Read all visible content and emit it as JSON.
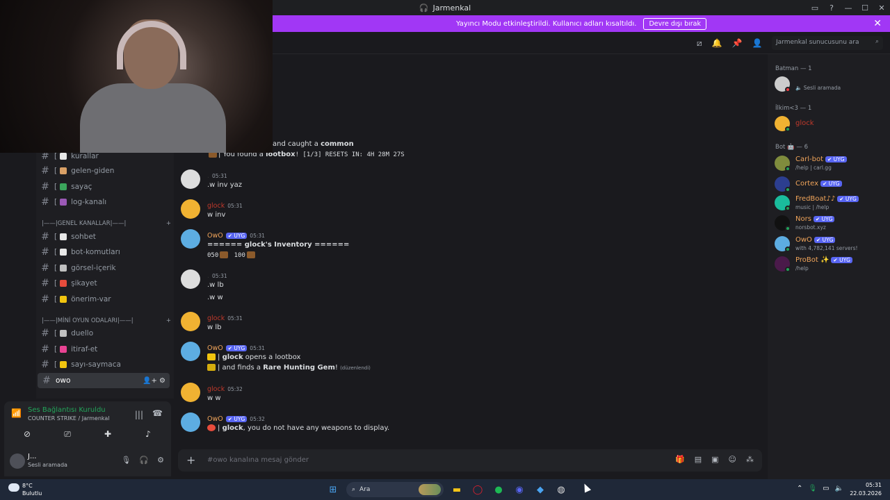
{
  "window": {
    "title": "Jarmenkal",
    "icons": [
      "inbox-icon",
      "help-icon",
      "minimize-icon",
      "maximize-icon",
      "close-icon"
    ]
  },
  "banner": {
    "text": "Yayıncı Modu etkinleştirildi. Kullanıcı adları kısaltıldı.",
    "button": "Devre dışı bırak"
  },
  "sidebar": {
    "channels": [
      {
        "name": "kurallar",
        "color": "#e8e8e8"
      },
      {
        "name": "gelen-giden",
        "color": "#d9a066"
      },
      {
        "name": "sayaç",
        "color": "#3ba55c"
      },
      {
        "name": "log-kanalı",
        "color": "#9b59b6"
      }
    ],
    "category1": "|——|GENEL KANALLAR|——|",
    "channels2": [
      {
        "name": "sohbet",
        "color": "#e8e8e8"
      },
      {
        "name": "bot-komutları",
        "color": "#e8e8e8"
      },
      {
        "name": "görsel-içerik",
        "color": "#c0c0c0"
      },
      {
        "name": "şikayet",
        "color": "#e74c3c"
      },
      {
        "name": "önerim-var",
        "color": "#f1c40f"
      }
    ],
    "category2": "|——|MİNİ OYUN ODALARI|——|",
    "channels3": [
      {
        "name": "duello",
        "color": "#c0c0c0"
      },
      {
        "name": "itiraf-et",
        "color": "#e84393"
      },
      {
        "name": "sayı-saymaca",
        "color": "#f1c40f"
      }
    ],
    "active_channel": "owo"
  },
  "voice": {
    "title": "Ses Bağlantısı Kuruldu",
    "subtitle": "COUNTER STRIKE / Jarmenkal"
  },
  "user": {
    "name": "J...",
    "status": "Sesli aramada"
  },
  "search": {
    "placeholder": "Jarmenkal sunucusunu ara"
  },
  "messages": {
    "top1": "and caught a ",
    "top1b": "common",
    "top2": "| You found a ",
    "top2b": "lootbox",
    "top2c": "! [1/3] RESETS IN: 4H 28M 27S",
    "m1": {
      "time": "05:31",
      "text": ".w inv yaz"
    },
    "m2": {
      "name": "glock",
      "time": "05:31",
      "text": "w inv"
    },
    "m3": {
      "name": "OwO",
      "badge": "✔ UYG",
      "time": "05:31",
      "line1": "====== glock's Inventory ======",
      "line2a": "050",
      "line2b": "100"
    },
    "m4": {
      "time": "05:31",
      "line1": ".w lb",
      "line2": ".w w"
    },
    "m5": {
      "name": "glock",
      "time": "05:31",
      "text": "w lb"
    },
    "m6": {
      "name": "OwO",
      "badge": "✔ UYG",
      "time": "05:31",
      "line1a": "| ",
      "line1b": "glock",
      "line1c": " opens a lootbox",
      "line2a": "| and finds a ",
      "line2b": "Rare Hunting Gem",
      "line2c": "!",
      "edited": "(düzenlendi)"
    },
    "m7": {
      "name": "glock",
      "time": "05:32",
      "text": "w w"
    },
    "m8": {
      "name": "OwO",
      "badge": "✔ UYG",
      "time": "05:32",
      "line1a": "| ",
      "line1b": "glock",
      "line1c": ", you do not have any weapons to display."
    }
  },
  "composer": {
    "placeholder": "#owo kanalına mesaj gönder"
  },
  "members": {
    "group1": "Batman — 1",
    "g1_status": "Sesli aramada",
    "group2": "İlkim<3 — 1",
    "g2_name": "glock",
    "group3": "Bot",
    "group3_count": "— 6",
    "bots": [
      {
        "name": "Carl-bot",
        "status": "/help | carl.gg",
        "color": "#f0a45a"
      },
      {
        "name": "Cortex",
        "status": "",
        "color": "#f0a45a"
      },
      {
        "name": "FredBoat♪♪",
        "status": "music | /help",
        "color": "#f0a45a"
      },
      {
        "name": "Nors",
        "status": "norsbot.xyz",
        "color": "#f0a45a"
      },
      {
        "name": "OwO",
        "status": "with 4,782,141 servers!",
        "color": "#f0a45a"
      },
      {
        "name": "ProBot ✨",
        "status": "/help",
        "color": "#f0a45a"
      }
    ],
    "badge": "✔ UYG"
  },
  "taskbar": {
    "weather_temp": "8°C",
    "weather_desc": "Bulutlu",
    "search": "Ara",
    "time": "05:31",
    "date": "22.03.2026"
  }
}
